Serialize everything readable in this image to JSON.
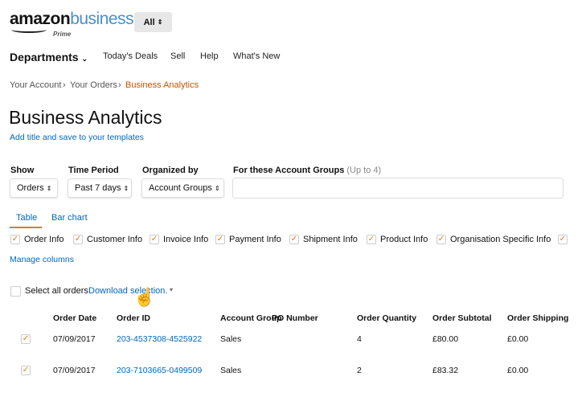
{
  "header": {
    "logo_main": "amazon",
    "logo_business": "business",
    "logo_sub": "Prime",
    "search_scope": "All"
  },
  "nav": {
    "departments": "Departments",
    "items": [
      "Today's Deals",
      "Sell",
      "Help",
      "What's New"
    ]
  },
  "breadcrumb": [
    "Your Account",
    "Your Orders",
    "Business Analytics"
  ],
  "page": {
    "title": "Business Analytics",
    "subtitle_link": "Add title and save to your templates"
  },
  "filters": {
    "show": {
      "label": "Show",
      "value": "Orders"
    },
    "time_period": {
      "label": "Time Period",
      "value": "Past 7 days"
    },
    "organized_by": {
      "label": "Organized by",
      "value": "Account Groups"
    },
    "account_groups": {
      "label": "For these Account Groups",
      "hint": "(Up to 4)"
    }
  },
  "tabs": [
    "Table",
    "Bar chart"
  ],
  "column_groups": [
    "Order Info",
    "Customer Info",
    "Invoice Info",
    "Payment Info",
    "Shipment Info",
    "Product Info",
    "Organisation Specific Info"
  ],
  "manage_columns": "Manage columns",
  "selection": {
    "select_all": "Select all orders",
    "download": "Download selection.",
    "caret": "▾"
  },
  "table": {
    "headers": [
      "Order Date",
      "Order ID",
      "Account Group",
      "PO Number",
      "Order Quantity",
      "Order Subtotal",
      "Order Shipping"
    ],
    "rows": [
      [
        "07/09/2017",
        "203-4537308-4525922",
        "Sales",
        "",
        "4",
        "£80.00",
        "£0.00"
      ],
      [
        "07/09/2017",
        "203-7103665-0499509",
        "Sales",
        "",
        "2",
        "£83.32",
        "£0.00"
      ]
    ]
  },
  "colors": {
    "accent": "#e47911",
    "link": "#0066c0",
    "breadcrumb_active": "#c45500"
  }
}
